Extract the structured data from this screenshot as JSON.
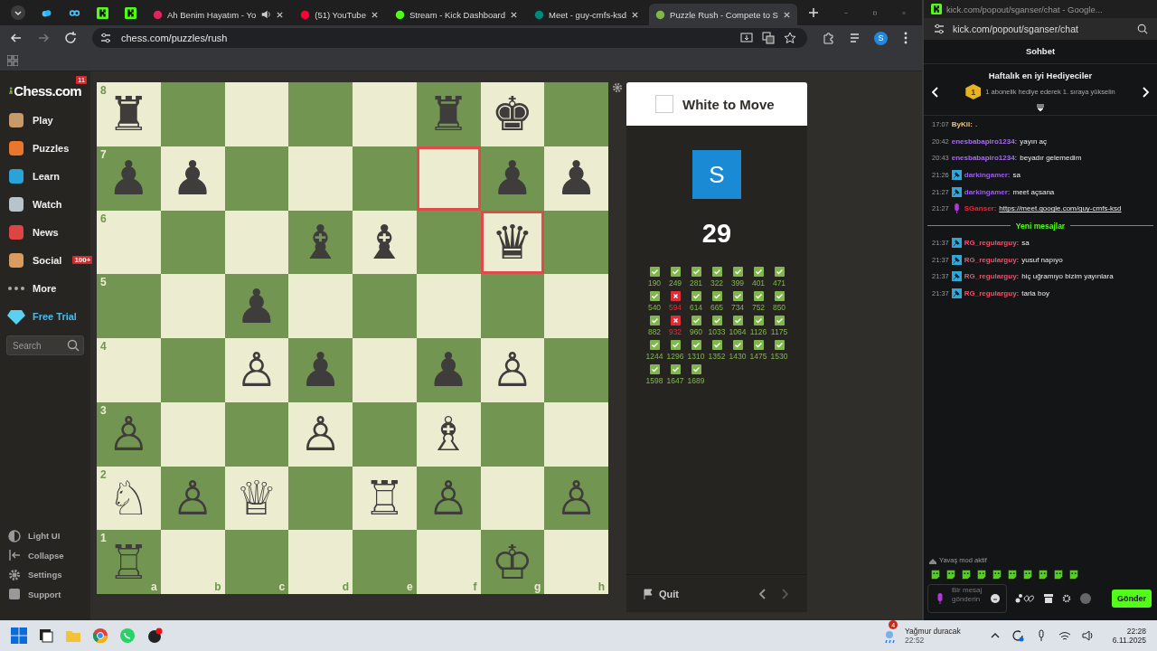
{
  "browser": {
    "tabs": [
      {
        "kind": "youtube-music",
        "title": "Ah Benim Hayatım - Yo",
        "playing_audio": true,
        "selected": false
      },
      {
        "kind": "youtube",
        "title": "(51) YouTube",
        "playing_audio": false,
        "selected": false
      },
      {
        "kind": "kick",
        "title": "Stream - Kick Dashboard",
        "playing_audio": false,
        "selected": false
      },
      {
        "kind": "meet",
        "title": "Meet - guy-cmfs-ksd",
        "playing_audio": false,
        "selected": false
      },
      {
        "kind": "chess",
        "title": "Puzzle Rush - Compete to S",
        "playing_audio": false,
        "selected": true
      }
    ],
    "address": "chess.com/puzzles/rush",
    "profile": "S"
  },
  "sidebar": {
    "logo": "Chess.com",
    "logo_badge": "11",
    "items": [
      {
        "kind": "play",
        "label": "Play"
      },
      {
        "kind": "puzzles",
        "label": "Puzzles"
      },
      {
        "kind": "learn",
        "label": "Learn"
      },
      {
        "kind": "watch",
        "label": "Watch"
      },
      {
        "kind": "news",
        "label": "News"
      },
      {
        "kind": "social",
        "label": "Social",
        "badge": "100+"
      },
      {
        "kind": "more",
        "label": "More"
      },
      {
        "kind": "trial",
        "label": "Free Trial"
      }
    ],
    "search": {
      "placeholder": "Search"
    },
    "footer": [
      {
        "kind": "theme",
        "label": "Light UI"
      },
      {
        "kind": "collapse",
        "label": "Collapse"
      },
      {
        "kind": "settings",
        "label": "Settings"
      },
      {
        "kind": "support",
        "label": "Support"
      }
    ]
  },
  "board": {
    "rank_labels": [
      "8",
      "7",
      "6",
      "5",
      "4",
      "3",
      "2",
      "1"
    ],
    "file_labels": [
      "a",
      "b",
      "c",
      "d",
      "e",
      "f",
      "g",
      "h"
    ],
    "rows": [
      [
        {
          "piece": "♜",
          "highlighted": false
        },
        {
          "highlighted": false
        },
        {
          "highlighted": false
        },
        {
          "highlighted": false
        },
        {
          "highlighted": false
        },
        {
          "piece": "♜",
          "highlighted": false
        },
        {
          "piece": "♚",
          "highlighted": false
        },
        {
          "highlighted": false
        }
      ],
      [
        {
          "piece": "♟",
          "highlighted": false
        },
        {
          "piece": "♟",
          "highlighted": false
        },
        {
          "highlighted": false
        },
        {
          "highlighted": false
        },
        {
          "highlighted": false
        },
        {
          "highlighted": true
        },
        {
          "piece": "♟",
          "highlighted": false
        },
        {
          "piece": "♟",
          "highlighted": false
        }
      ],
      [
        {
          "highlighted": false
        },
        {
          "highlighted": false
        },
        {
          "highlighted": false
        },
        {
          "piece": "♝",
          "highlighted": false
        },
        {
          "piece": "♝",
          "highlighted": false
        },
        {
          "highlighted": false
        },
        {
          "piece": "♛",
          "highlighted": true
        },
        {
          "highlighted": false
        }
      ],
      [
        {
          "highlighted": false
        },
        {
          "highlighted": false
        },
        {
          "piece": "♟",
          "highlighted": false
        },
        {
          "highlighted": false
        },
        {
          "highlighted": false
        },
        {
          "highlighted": false
        },
        {
          "highlighted": false
        },
        {
          "highlighted": false
        }
      ],
      [
        {
          "highlighted": false
        },
        {
          "highlighted": false
        },
        {
          "piece": "♙",
          "highlighted": false
        },
        {
          "piece": "♟",
          "highlighted": false
        },
        {
          "highlighted": false
        },
        {
          "piece": "♟",
          "highlighted": false
        },
        {
          "piece": "♙",
          "highlighted": false
        },
        {
          "highlighted": false
        }
      ],
      [
        {
          "piece": "♙",
          "highlighted": false
        },
        {
          "highlighted": false
        },
        {
          "highlighted": false
        },
        {
          "piece": "♙",
          "highlighted": false
        },
        {
          "highlighted": false
        },
        {
          "piece": "♗",
          "highlighted": false
        },
        {
          "highlighted": false
        },
        {
          "highlighted": false
        }
      ],
      [
        {
          "piece": "♘",
          "highlighted": false
        },
        {
          "piece": "♙",
          "highlighted": false
        },
        {
          "piece": "♕",
          "highlighted": false
        },
        {
          "highlighted": false
        },
        {
          "piece": "♖",
          "highlighted": false
        },
        {
          "piece": "♙",
          "highlighted": false
        },
        {
          "highlighted": false
        },
        {
          "piece": "♙",
          "highlighted": false
        }
      ],
      [
        {
          "piece": "♖",
          "highlighted": false
        },
        {
          "highlighted": false
        },
        {
          "highlighted": false
        },
        {
          "highlighted": false
        },
        {
          "highlighted": false
        },
        {
          "highlighted": false
        },
        {
          "piece": "♔",
          "highlighted": false
        },
        {
          "highlighted": false
        }
      ]
    ]
  },
  "panel": {
    "turn": "White to Move",
    "avatar": "S",
    "score": "29",
    "results": [
      {
        "value": "190",
        "solved": true
      },
      {
        "value": "249",
        "solved": true
      },
      {
        "value": "281",
        "solved": true
      },
      {
        "value": "322",
        "solved": true
      },
      {
        "value": "399",
        "solved": true
      },
      {
        "value": "401",
        "solved": true
      },
      {
        "value": "471",
        "solved": true
      },
      {
        "value": "540",
        "solved": true
      },
      {
        "value": "594",
        "solved": false
      },
      {
        "value": "614",
        "solved": true
      },
      {
        "value": "665",
        "solved": true
      },
      {
        "value": "734",
        "solved": true
      },
      {
        "value": "752",
        "solved": true
      },
      {
        "value": "850",
        "solved": true
      },
      {
        "value": "882",
        "solved": true
      },
      {
        "value": "932",
        "solved": false
      },
      {
        "value": "960",
        "solved": true
      },
      {
        "value": "1033",
        "solved": true
      },
      {
        "value": "1064",
        "solved": true
      },
      {
        "value": "1126",
        "solved": true
      },
      {
        "value": "1175",
        "solved": true
      },
      {
        "value": "1244",
        "solved": true
      },
      {
        "value": "1296",
        "solved": true
      },
      {
        "value": "1310",
        "solved": true
      },
      {
        "value": "1352",
        "solved": true
      },
      {
        "value": "1430",
        "solved": true
      },
      {
        "value": "1475",
        "solved": true
      },
      {
        "value": "1530",
        "solved": true
      },
      {
        "value": "1598",
        "solved": true
      },
      {
        "value": "1647",
        "solved": true
      },
      {
        "value": "1689",
        "solved": true
      }
    ],
    "quit": "Quit"
  },
  "chat_window": {
    "title": "kick.com/popout/sganser/chat - Google...",
    "address": "kick.com/popout/sganser/chat",
    "heading": "Sohbet",
    "gifters_title": "Haftalık en iyi Hediyeciler",
    "rank_badge": "1",
    "gifters_text": "1 abonelik hediye ederek 1. sıraya yükselin",
    "messages": [
      {
        "time": "17:07",
        "kind": "plain",
        "user": "ByKil:",
        "color": "#f2c46b",
        "text": ".",
        "link": false
      },
      {
        "time": "20:42",
        "kind": "plain",
        "user": "enesbabapiro1234:",
        "color": "#a66cf0",
        "text": "yayın aç",
        "link": false
      },
      {
        "time": "20:43",
        "kind": "plain",
        "user": "enesbabapiro1234:",
        "color": "#a66cf0",
        "text": "beyadır gelemedim",
        "link": false
      },
      {
        "time": "21:26",
        "kind": "subscriber",
        "user": "darkingamer:",
        "color": "#9a5cf0",
        "text": "sa",
        "link": false
      },
      {
        "time": "21:27",
        "kind": "subscriber",
        "user": "darkingamer:",
        "color": "#9a5cf0",
        "text": "meet açsana",
        "link": false
      },
      {
        "time": "21:27",
        "kind": "broadcaster",
        "user": "SGanser:",
        "color": "#e02d3c",
        "text": "https://meet.google.com/guy-cmfs-ksd",
        "link": true
      }
    ],
    "new_divider": "Yeni mesajlar",
    "new_messages": [
      {
        "time": "21:37",
        "kind": "subscriber",
        "user": "RG_regularguy:",
        "color": "#f0506e",
        "text": "sa",
        "link": false
      },
      {
        "time": "21:37",
        "kind": "subscriber",
        "user": "RG_regularguy:",
        "color": "#f0506e",
        "text": "yusuf napıyo",
        "link": false
      },
      {
        "time": "21:37",
        "kind": "subscriber",
        "user": "RG_regularguy:",
        "color": "#f0506e",
        "text": "hiç uğramıyo bizim yayınlara",
        "link": false
      },
      {
        "time": "21:37",
        "kind": "subscriber",
        "user": "RG_regularguy:",
        "color": "#f0506e",
        "text": "tarla boy",
        "link": false
      }
    ],
    "slow_mode": "Yavaş mod aktif",
    "input": {
      "placeholder": "Bir mesaj gönderin"
    },
    "send": "Gönder"
  },
  "taskbar": {
    "weather": "Yağmur duracak",
    "weather_time": "22:52",
    "weather_badge": "4",
    "time": "22:28",
    "date": "6.11.2025"
  }
}
